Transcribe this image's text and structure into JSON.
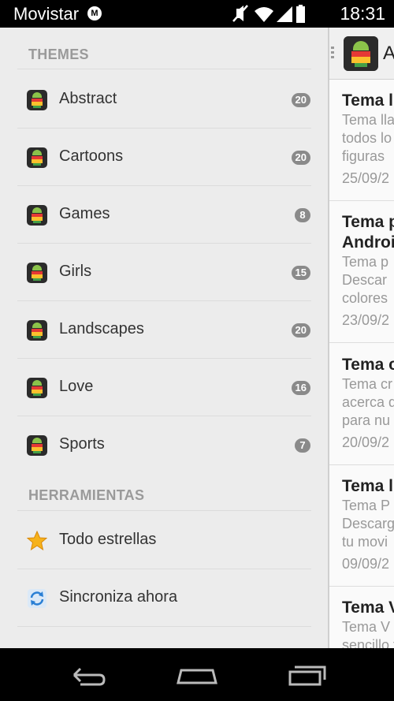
{
  "status_bar": {
    "carrier": "Movistar",
    "carrier_logo": "M",
    "time": "18:31"
  },
  "drawer": {
    "themes_header": "THEMES",
    "themes": [
      {
        "label": "Abstract",
        "count": "20"
      },
      {
        "label": "Cartoons",
        "count": "20"
      },
      {
        "label": "Games",
        "count": "8"
      },
      {
        "label": "Girls",
        "count": "15"
      },
      {
        "label": "Landscapes",
        "count": "20"
      },
      {
        "label": "Love",
        "count": "16"
      },
      {
        "label": "Sports",
        "count": "7"
      }
    ],
    "tools_header": "HERRAMIENTAS",
    "tools": [
      {
        "label": "Todo estrellas",
        "icon": "star-icon"
      },
      {
        "label": "Sincroniza ahora",
        "icon": "sync-icon"
      }
    ]
  },
  "panel": {
    "title": "A",
    "posts": [
      {
        "title": [
          "Tema l"
        ],
        "excerpt": [
          "Tema lla",
          "todos lo",
          "figuras"
        ],
        "date": "25/09/2"
      },
      {
        "title": [
          "Tema p",
          "Androi"
        ],
        "excerpt": [
          "Tema p",
          " Descar",
          "colores"
        ],
        "date": "23/09/2"
      },
      {
        "title": [
          "Tema c"
        ],
        "excerpt": [
          "Tema cr",
          "acerca d",
          "para nu"
        ],
        "date": "20/09/2"
      },
      {
        "title": [
          "Tema l"
        ],
        "excerpt": [
          "Tema P",
          "Descarg",
          "tu movi"
        ],
        "date": "09/09/2"
      },
      {
        "title": [
          "Tema V"
        ],
        "excerpt": [
          "Tema V",
          "sencillo t"
        ],
        "date": ""
      }
    ]
  },
  "colors": {
    "drawer_bg": "#ececec",
    "badge": "#8a8a8a",
    "section_header": "#9a9a9a"
  }
}
